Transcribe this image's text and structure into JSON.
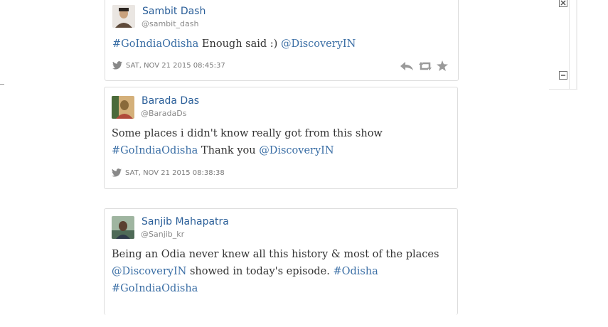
{
  "tweets": [
    {
      "name": "Sambit Dash",
      "handle": "@sambit_dash",
      "text_parts": [
        "#GoIndiaOdisha",
        " Enough said :) ",
        "@DiscoveryIN"
      ],
      "timestamp": "SAT, NOV 21 2015 08:45:37",
      "avatar_color": "#c9a27e"
    },
    {
      "name": "Barada Das",
      "handle": "@BaradaDs",
      "line1": "Some places i didn't know really got from this show",
      "line2_parts": [
        "#GoIndiaOdisha",
        " Thank you ",
        "@DiscoveryIN"
      ],
      "timestamp": "SAT, NOV 21 2015 08:38:38",
      "avatar_color": "#8a6a3a"
    },
    {
      "name": "Sanjib Mahapatra",
      "handle": "@Sanjib_kr",
      "line1": "Being an Odia never knew all this history & most of the places",
      "line2_parts": [
        "@DiscoveryIN",
        " showed in today's episode. ",
        "#Odisha"
      ],
      "line3": "#GoIndiaOdisha",
      "avatar_color": "#4e6a57"
    }
  ],
  "icons": {
    "bird": "twitter-bird-icon",
    "reply": "reply-icon",
    "retweet": "retweet-icon",
    "favorite": "star-icon",
    "close": "close-icon",
    "minimize": "minimize-icon"
  },
  "colors": {
    "link": "#3a6ea5",
    "name": "#2b5f99",
    "meta": "#7a7a7a"
  }
}
